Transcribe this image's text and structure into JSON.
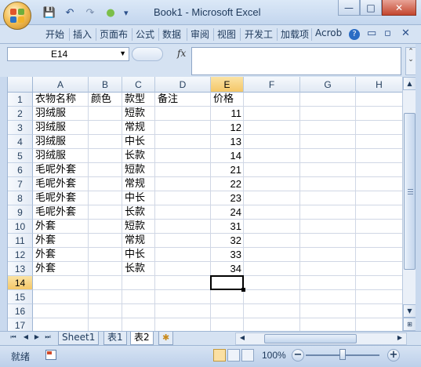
{
  "window": {
    "title": "Book1 - Microsoft Excel",
    "buttons": {
      "minimize": "—",
      "maximize": "□",
      "close": "✕"
    }
  },
  "quick_access": {
    "save": "💾",
    "undo": "↶",
    "redo": "↷",
    "circle": "●",
    "customize": "▾"
  },
  "ribbon": {
    "tabs": [
      "开始",
      "插入",
      "页面布",
      "公式",
      "数据",
      "审阅",
      "视图",
      "开发工",
      "加载项",
      "Acrob"
    ],
    "help": "?",
    "minimize": "▭",
    "restore": "▫",
    "close": "✕"
  },
  "formula_bar": {
    "name_box": "E14",
    "fx": "fx",
    "content": ""
  },
  "columns": [
    "A",
    "B",
    "C",
    "D",
    "E",
    "F",
    "G",
    "H"
  ],
  "selected_column": "E",
  "rows": [
    "1",
    "2",
    "3",
    "4",
    "5",
    "6",
    "7",
    "8",
    "9",
    "10",
    "11",
    "12",
    "13",
    "14",
    "15",
    "16",
    "17"
  ],
  "selected_row": "14",
  "sheet": {
    "headers": {
      "A": "衣物名称",
      "B": "颜色",
      "C": "款型",
      "D": "备注",
      "E": "价格"
    },
    "data": [
      {
        "A": "羽绒服",
        "C": "短款",
        "E": "11"
      },
      {
        "A": "羽绒服",
        "C": "常规",
        "E": "12"
      },
      {
        "A": "羽绒服",
        "C": "中长",
        "E": "13"
      },
      {
        "A": "羽绒服",
        "C": "长款",
        "E": "14"
      },
      {
        "A": "毛呢外套",
        "C": "短款",
        "E": "21"
      },
      {
        "A": "毛呢外套",
        "C": "常规",
        "E": "22"
      },
      {
        "A": "毛呢外套",
        "C": "中长",
        "E": "23"
      },
      {
        "A": "毛呢外套",
        "C": "长款",
        "E": "24"
      },
      {
        "A": "外套",
        "C": "短款",
        "E": "31"
      },
      {
        "A": "外套",
        "C": "常规",
        "E": "32"
      },
      {
        "A": "外套",
        "C": "中长",
        "E": "33"
      },
      {
        "A": "外套",
        "C": "长款",
        "E": "34"
      }
    ]
  },
  "sheet_tabs": {
    "nav": [
      "⏮",
      "◀",
      "▶",
      "⏭"
    ],
    "tabs": [
      "Sheet1",
      "表1",
      "表2"
    ],
    "active": "表2",
    "insert": "✱"
  },
  "status_bar": {
    "ready": "就绪",
    "zoom": "100%",
    "zoom_out": "−",
    "zoom_in": "+",
    "zoom_level": 0.5
  },
  "colors": {
    "accent": "#c9d9ee",
    "selected_header": "#f4c768"
  }
}
